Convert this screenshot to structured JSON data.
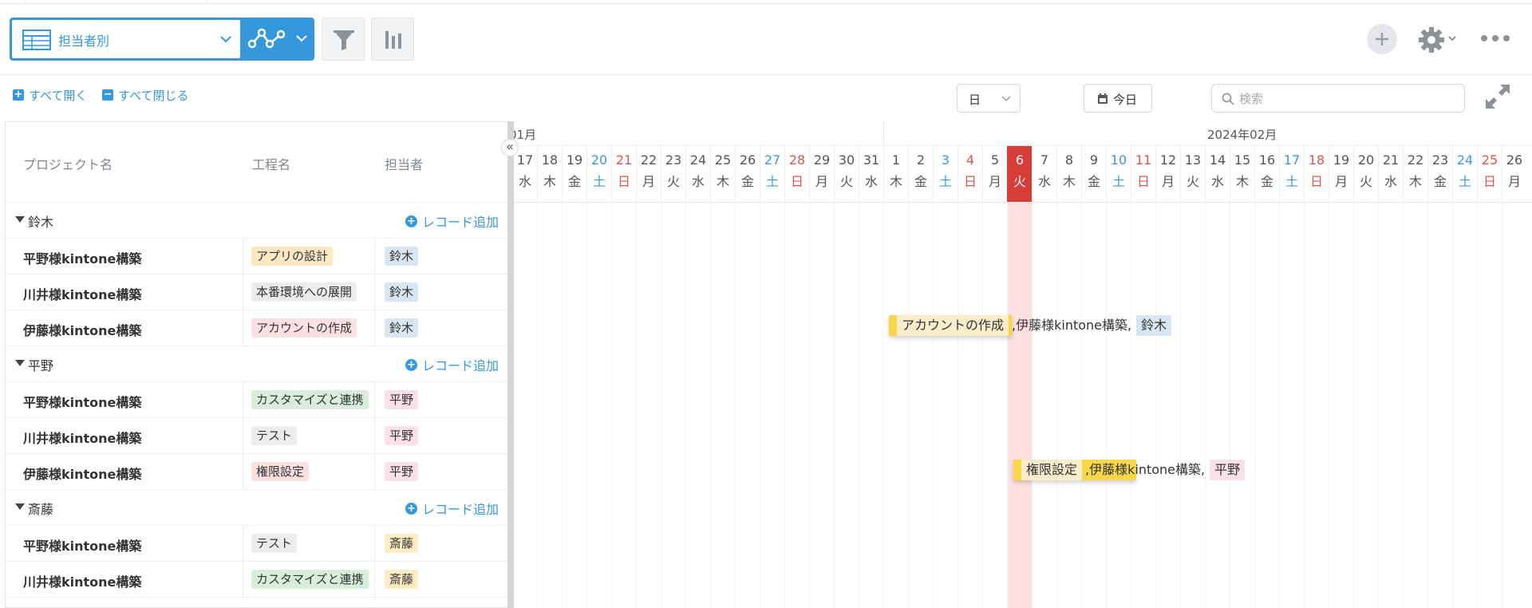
{
  "toolbar": {
    "view_label": "担当者別"
  },
  "links": {
    "expand_all": "すべて開く",
    "collapse_all": "すべて閉じる"
  },
  "controls": {
    "scale": "日",
    "today": "今日",
    "search_placeholder": "検索"
  },
  "columns": {
    "project": "プロジェクト名",
    "process": "工程名",
    "assignee": "担当者"
  },
  "add_record_label": "レコード追加",
  "groups": [
    {
      "name": "鈴木",
      "records": [
        {
          "project": "平野様kintone構築",
          "process": "アプリの設計",
          "process_color": "#fde8c4",
          "assignee": "鈴木",
          "assignee_color": "#d7e6f2"
        },
        {
          "project": "川井様kintone構築",
          "process": "本番環境への展開",
          "process_color": "#ececec",
          "assignee": "鈴木",
          "assignee_color": "#d7e6f2"
        },
        {
          "project": "伊藤様kintone構築",
          "process": "アカウントの作成",
          "process_color": "#fde0e4",
          "assignee": "鈴木",
          "assignee_color": "#d7e6f2"
        }
      ]
    },
    {
      "name": "平野",
      "records": [
        {
          "project": "平野様kintone構築",
          "process": "カスタマイズと連携",
          "process_color": "#d8eedb",
          "assignee": "平野",
          "assignee_color": "#fbe1e7"
        },
        {
          "project": "川井様kintone構築",
          "process": "テスト",
          "process_color": "#ececec",
          "assignee": "平野",
          "assignee_color": "#fbe1e7"
        },
        {
          "project": "伊藤様kintone構築",
          "process": "権限設定",
          "process_color": "#fde0e0",
          "assignee": "平野",
          "assignee_color": "#fbe1e7"
        }
      ]
    },
    {
      "name": "斎藤",
      "records": [
        {
          "project": "平野様kintone構築",
          "process": "テスト",
          "process_color": "#ececec",
          "assignee": "斎藤",
          "assignee_color": "#fdebc4"
        },
        {
          "project": "川井様kintone構築",
          "process": "カスタマイズと連携",
          "process_color": "#d8eedb",
          "assignee": "斎藤",
          "assignee_color": "#fdebc4"
        }
      ]
    }
  ],
  "timeline": {
    "months": [
      {
        "label": "01月"
      },
      {
        "label": "2024年02月"
      }
    ],
    "days": [
      {
        "d": "17",
        "w": "水",
        "type": ""
      },
      {
        "d": "18",
        "w": "木",
        "type": ""
      },
      {
        "d": "19",
        "w": "金",
        "type": ""
      },
      {
        "d": "20",
        "w": "土",
        "type": "sat"
      },
      {
        "d": "21",
        "w": "日",
        "type": "sun"
      },
      {
        "d": "22",
        "w": "月",
        "type": ""
      },
      {
        "d": "23",
        "w": "火",
        "type": ""
      },
      {
        "d": "24",
        "w": "水",
        "type": ""
      },
      {
        "d": "25",
        "w": "木",
        "type": ""
      },
      {
        "d": "26",
        "w": "金",
        "type": ""
      },
      {
        "d": "27",
        "w": "土",
        "type": "sat"
      },
      {
        "d": "28",
        "w": "日",
        "type": "sun"
      },
      {
        "d": "29",
        "w": "月",
        "type": ""
      },
      {
        "d": "30",
        "w": "火",
        "type": ""
      },
      {
        "d": "31",
        "w": "水",
        "type": ""
      },
      {
        "d": "1",
        "w": "木",
        "type": ""
      },
      {
        "d": "2",
        "w": "金",
        "type": ""
      },
      {
        "d": "3",
        "w": "土",
        "type": "sat"
      },
      {
        "d": "4",
        "w": "日",
        "type": "sun"
      },
      {
        "d": "5",
        "w": "月",
        "type": ""
      },
      {
        "d": "6",
        "w": "火",
        "type": "today"
      },
      {
        "d": "7",
        "w": "水",
        "type": ""
      },
      {
        "d": "8",
        "w": "木",
        "type": ""
      },
      {
        "d": "9",
        "w": "金",
        "type": ""
      },
      {
        "d": "10",
        "w": "土",
        "type": "sat"
      },
      {
        "d": "11",
        "w": "日",
        "type": "sun"
      },
      {
        "d": "12",
        "w": "月",
        "type": ""
      },
      {
        "d": "13",
        "w": "火",
        "type": ""
      },
      {
        "d": "14",
        "w": "水",
        "type": ""
      },
      {
        "d": "15",
        "w": "木",
        "type": ""
      },
      {
        "d": "16",
        "w": "金",
        "type": ""
      },
      {
        "d": "17",
        "w": "土",
        "type": "sat"
      },
      {
        "d": "18",
        "w": "日",
        "type": "sun"
      },
      {
        "d": "19",
        "w": "月",
        "type": ""
      },
      {
        "d": "20",
        "w": "火",
        "type": ""
      },
      {
        "d": "21",
        "w": "水",
        "type": ""
      },
      {
        "d": "22",
        "w": "木",
        "type": ""
      },
      {
        "d": "23",
        "w": "金",
        "type": ""
      },
      {
        "d": "24",
        "w": "土",
        "type": "sat"
      },
      {
        "d": "25",
        "w": "日",
        "type": "sun"
      },
      {
        "d": "26",
        "w": "月",
        "type": ""
      }
    ],
    "bars": [
      {
        "process": "アカウントの作成",
        "project": "伊藤様kintone構築",
        "assignee": "鈴木",
        "assignee_color": "#d7e6f2"
      },
      {
        "process": "権限設定",
        "project": "伊藤様kintone構築",
        "assignee": "平野",
        "assignee_color": "#fbe1e7"
      }
    ]
  },
  "colors": {
    "accent": "#3498db",
    "today": "#d53d36",
    "bar": "#f9d749"
  }
}
